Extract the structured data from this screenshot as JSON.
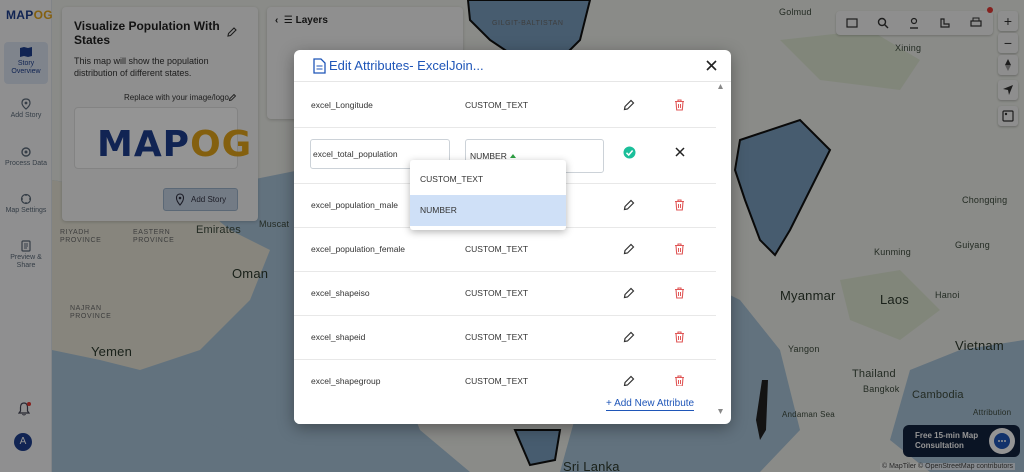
{
  "app": {
    "logo_main": "MAP",
    "logo_accent": "OG"
  },
  "rail": {
    "items": [
      {
        "label": "Story Overview",
        "icon": "map-icon",
        "active": true
      },
      {
        "label": "Add Story",
        "icon": "pin-icon",
        "active": false
      },
      {
        "label": "Process Data",
        "icon": "gear-icon",
        "active": false
      },
      {
        "label": "Map Settings",
        "icon": "settings-icon",
        "active": false
      },
      {
        "label": "Preview & Share",
        "icon": "share-icon",
        "active": false
      }
    ],
    "avatar_initial": "A"
  },
  "story": {
    "title": "Visualize Population With States",
    "description": "This map will show the population distribution of different states.",
    "replace_label": "Replace with your image/logo",
    "logo_main": "MAP",
    "logo_accent": "OG",
    "add_story_label": "Add Story"
  },
  "layers": {
    "title": "Layers"
  },
  "map_labels": {
    "emirates": "Emirates",
    "muscat": "Muscat",
    "oman": "Oman",
    "yemen": "Yemen",
    "eastern_province": "EASTERN PROVINCE",
    "riyadh_province": "RIYADH PROVINCE",
    "najran_province": "NAJRAN PROVINCE",
    "myanmar": "Myanmar",
    "laos": "Laos",
    "vietnam": "Vietnam",
    "thailand": "Thailand",
    "cambodia": "Cambodia",
    "sri_lanka": "Sri Lanka",
    "golmud": "Golmud",
    "xining": "Xining",
    "chongqing": "Chongqing",
    "guiyang": "Guiyang",
    "kunming": "Kunming",
    "hanoi": "Hanoi",
    "bangkok": "Bangkok",
    "yangon": "Yangon",
    "andaman_sea": "Andaman Sea",
    "gilgit": "GILGIT-BALTISTAN"
  },
  "consult": {
    "line1": "Free 15-min Map",
    "line2": "Consultation"
  },
  "attribution": "© MapTiler © OpenStreetMap contributors",
  "attribution_short": "Attribution",
  "modal": {
    "title": "Edit Attributes- ExcelJoin...",
    "rows": [
      {
        "name": "excel_Longitude",
        "type": "CUSTOM_TEXT"
      },
      {
        "name": "excel_total_population",
        "type": "NUMBER",
        "editing": true
      },
      {
        "name": "excel_population_male",
        "type": ""
      },
      {
        "name": "excel_population_female",
        "type": "CUSTOM_TEXT"
      },
      {
        "name": "excel_shapeiso",
        "type": "CUSTOM_TEXT"
      },
      {
        "name": "excel_shapeid",
        "type": "CUSTOM_TEXT"
      },
      {
        "name": "excel_shapegroup",
        "type": "CUSTOM_TEXT"
      }
    ],
    "dropdown_options": [
      "CUSTOM_TEXT",
      "NUMBER"
    ],
    "dropdown_selected": "NUMBER",
    "add_new_label": "+ Add New Attribute"
  },
  "colors": {
    "brand_blue": "#1e3f8f",
    "brand_gold": "#e3a51b",
    "modal_title": "#1f56b8",
    "delete_red": "#e05757",
    "confirm_green": "#1bbf9a",
    "selected_option": "#cfe0f7"
  }
}
